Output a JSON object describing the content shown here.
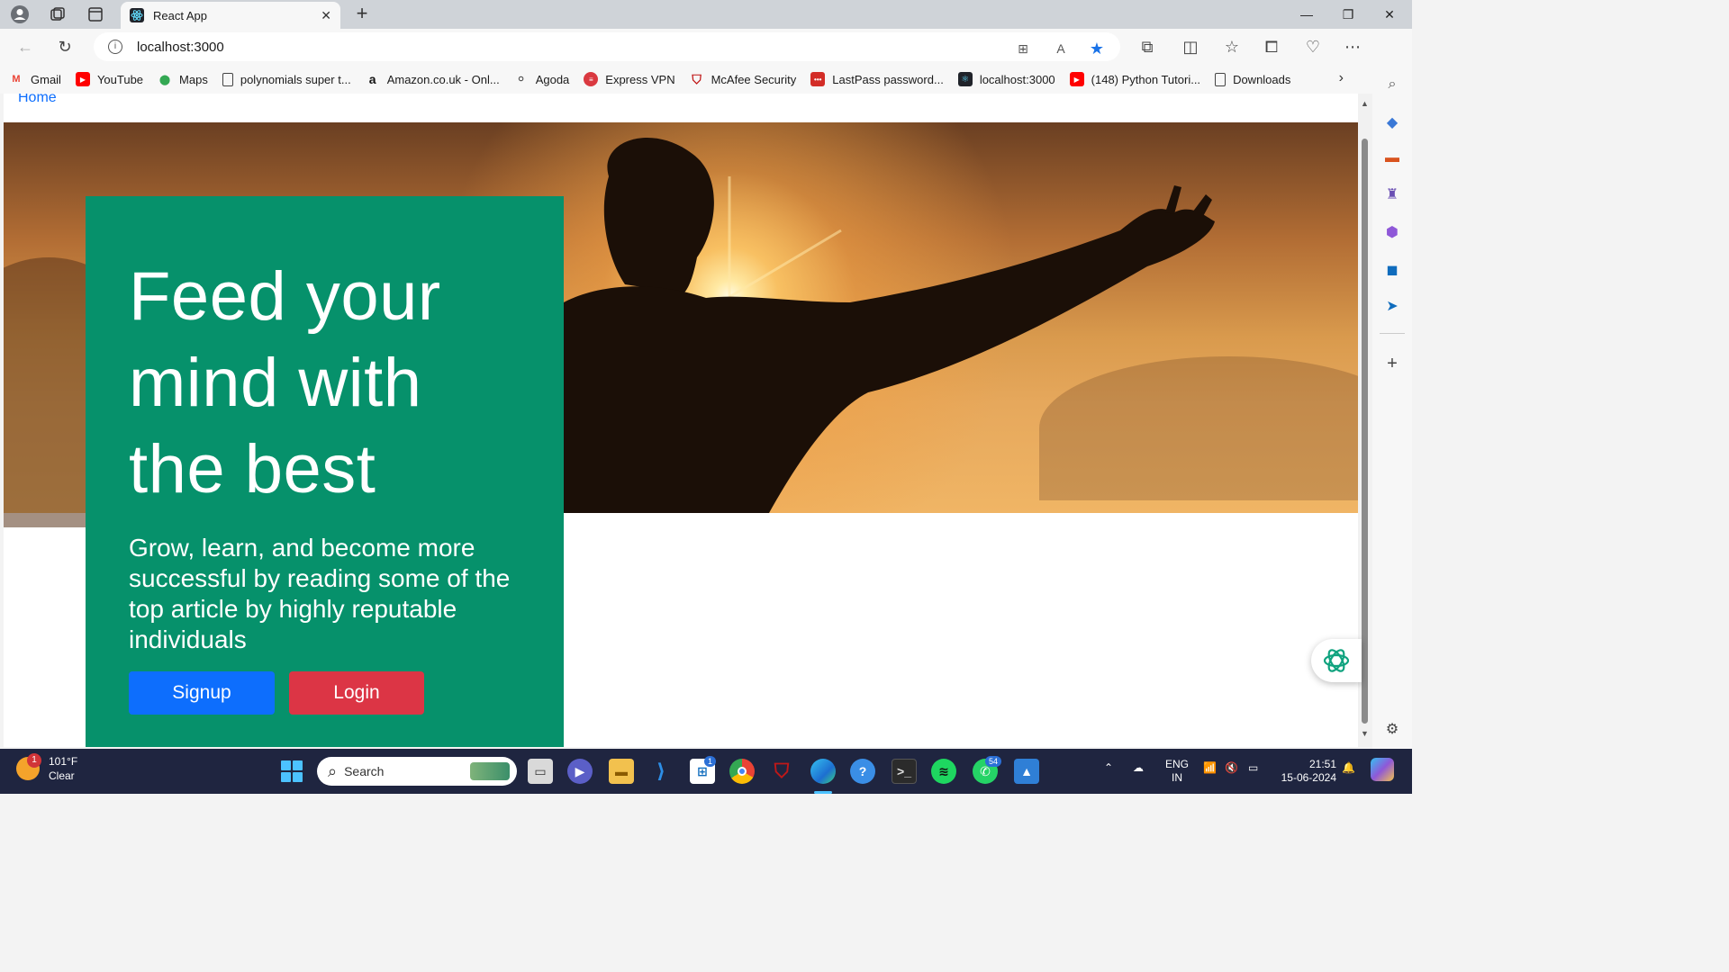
{
  "browser": {
    "tab_title": "React App",
    "url": "localhost:3000",
    "bookmarks": [
      {
        "label": "Gmail",
        "icon": "gmail-icon",
        "color": "#ea4335"
      },
      {
        "label": "YouTube",
        "icon": "youtube-icon",
        "color": "#ff0000"
      },
      {
        "label": "Maps",
        "icon": "maps-icon",
        "color": "#34a853"
      },
      {
        "label": "polynomials super t...",
        "icon": "page-icon",
        "color": "#444444"
      },
      {
        "label": "Amazon.co.uk - Onl...",
        "icon": "amazon-icon",
        "color": "#111111"
      },
      {
        "label": "Agoda",
        "icon": "agoda-icon",
        "color": "#444444"
      },
      {
        "label": "Express VPN",
        "icon": "expressvpn-icon",
        "color": "#da3940"
      },
      {
        "label": "McAfee Security",
        "icon": "mcafee-icon",
        "color": "#c01818"
      },
      {
        "label": "LastPass password...",
        "icon": "lastpass-icon",
        "color": "#d32d27"
      },
      {
        "label": "localhost:3000",
        "icon": "react-icon",
        "color": "#20232a"
      },
      {
        "label": "(148) Python Tutori...",
        "icon": "youtube-icon",
        "color": "#ff0000"
      },
      {
        "label": "Downloads",
        "icon": "page-icon",
        "color": "#444444"
      }
    ]
  },
  "page": {
    "nav_home": "Home",
    "hero_title": "Feed your mind with the best",
    "hero_subtitle": "Grow, learn, and become more successful by reading some of the top article by highly reputable individuals",
    "signup_label": "Signup",
    "login_label": "Login",
    "card_color": "#06916b",
    "signup_color": "#0d6efd",
    "login_color": "#dc3545"
  },
  "taskbar": {
    "weather_temp": "101°F",
    "weather_desc": "Clear",
    "weather_badge": "1",
    "search_placeholder": "Search",
    "store_badge": "1",
    "whatsapp_badge": "54",
    "lang_top": "ENG",
    "lang_bottom": "IN",
    "time": "21:51",
    "date": "15-06-2024"
  }
}
